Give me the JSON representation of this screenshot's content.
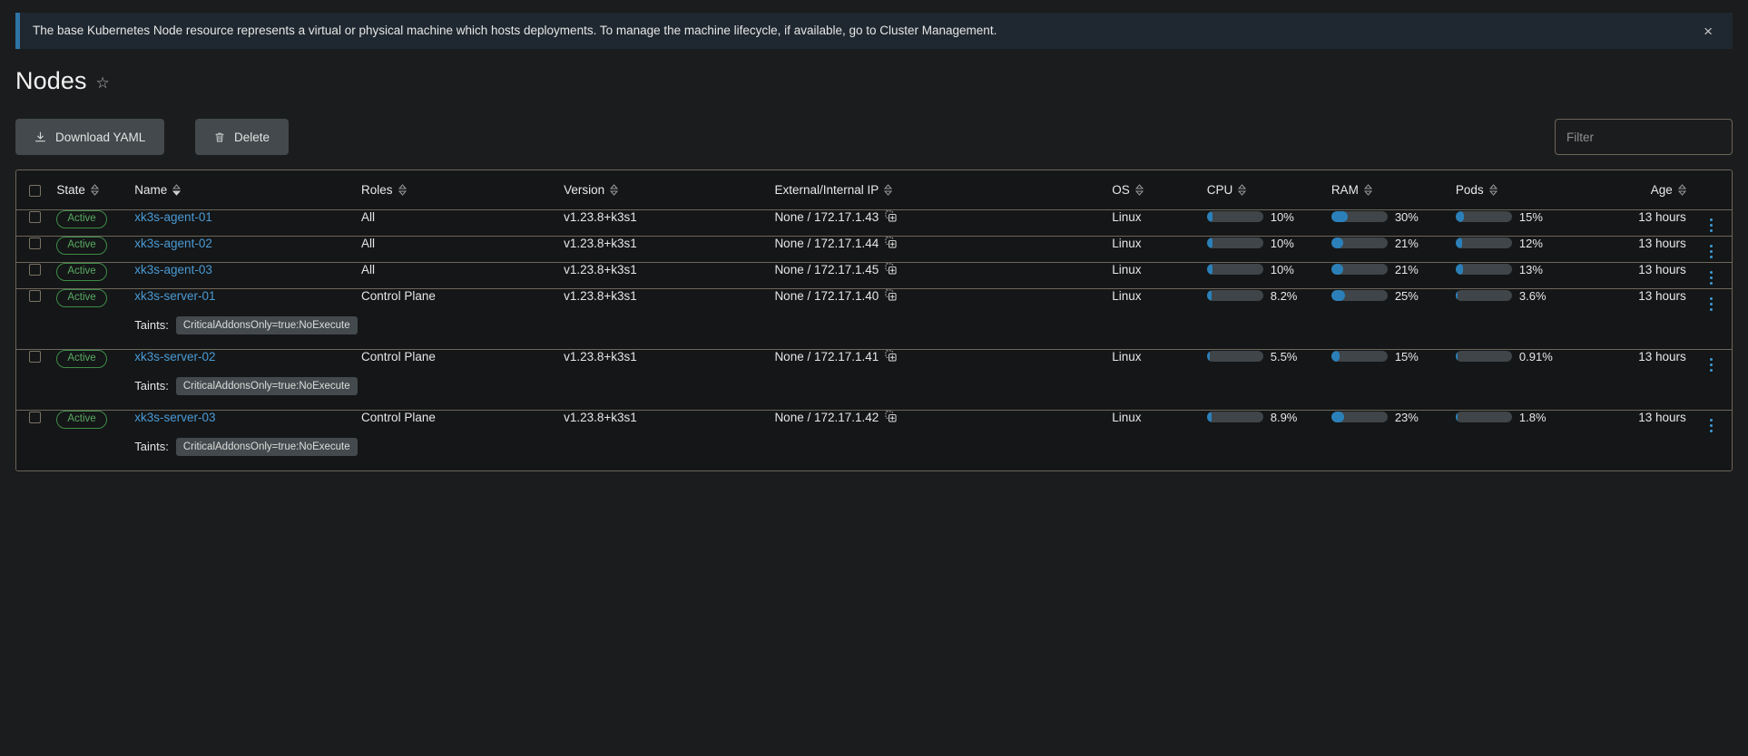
{
  "banner": {
    "message": "The base Kubernetes Node resource represents a virtual or physical machine which hosts deployments. To manage the machine lifecycle, if available, go to Cluster Management.",
    "close_label": "×",
    "accent_color": "#2e75a6",
    "background_color": "#1f2830"
  },
  "header": {
    "title": "Nodes",
    "favorite_icon": "star-icon"
  },
  "toolbar": {
    "download_yaml_label": "Download YAML",
    "download_icon": "download-icon",
    "delete_label": "Delete",
    "delete_icon": "trash-icon",
    "filter_placeholder": "Filter",
    "filter_value": ""
  },
  "table": {
    "columns": [
      {
        "key": "state",
        "label": "State",
        "sortable": true,
        "sorted": false
      },
      {
        "key": "name",
        "label": "Name",
        "sortable": true,
        "sorted": true
      },
      {
        "key": "roles",
        "label": "Roles",
        "sortable": true,
        "sorted": false
      },
      {
        "key": "version",
        "label": "Version",
        "sortable": true,
        "sorted": false
      },
      {
        "key": "ip",
        "label": "External/Internal IP",
        "sortable": true,
        "sorted": false
      },
      {
        "key": "os",
        "label": "OS",
        "sortable": true,
        "sorted": false
      },
      {
        "key": "cpu",
        "label": "CPU",
        "sortable": true,
        "sorted": false
      },
      {
        "key": "ram",
        "label": "RAM",
        "sortable": true,
        "sorted": false
      },
      {
        "key": "pods",
        "label": "Pods",
        "sortable": true,
        "sorted": false
      },
      {
        "key": "age",
        "label": "Age",
        "sortable": true,
        "sorted": false
      }
    ],
    "taints_label": "Taints:",
    "rows": [
      {
        "state": "Active",
        "name": "xk3s-agent-01",
        "roles": "All",
        "version": "v1.23.8+k3s1",
        "ip": "None / 172.17.1.43",
        "os": "Linux",
        "cpu": {
          "percent": 10,
          "text": "10%"
        },
        "ram": {
          "percent": 30,
          "text": "30%"
        },
        "pods": {
          "percent": 15,
          "text": "15%"
        },
        "age": "13 hours",
        "taints": null
      },
      {
        "state": "Active",
        "name": "xk3s-agent-02",
        "roles": "All",
        "version": "v1.23.8+k3s1",
        "ip": "None / 172.17.1.44",
        "os": "Linux",
        "cpu": {
          "percent": 10,
          "text": "10%"
        },
        "ram": {
          "percent": 21,
          "text": "21%"
        },
        "pods": {
          "percent": 12,
          "text": "12%"
        },
        "age": "13 hours",
        "taints": null
      },
      {
        "state": "Active",
        "name": "xk3s-agent-03",
        "roles": "All",
        "version": "v1.23.8+k3s1",
        "ip": "None / 172.17.1.45",
        "os": "Linux",
        "cpu": {
          "percent": 10,
          "text": "10%"
        },
        "ram": {
          "percent": 21,
          "text": "21%"
        },
        "pods": {
          "percent": 13,
          "text": "13%"
        },
        "age": "13 hours",
        "taints": null
      },
      {
        "state": "Active",
        "name": "xk3s-server-01",
        "roles": "Control Plane",
        "version": "v1.23.8+k3s1",
        "ip": "None / 172.17.1.40",
        "os": "Linux",
        "cpu": {
          "percent": 8.2,
          "text": "8.2%"
        },
        "ram": {
          "percent": 25,
          "text": "25%"
        },
        "pods": {
          "percent": 3.6,
          "text": "3.6%"
        },
        "age": "13 hours",
        "taints": "CriticalAddonsOnly=true:NoExecute"
      },
      {
        "state": "Active",
        "name": "xk3s-server-02",
        "roles": "Control Plane",
        "version": "v1.23.8+k3s1",
        "ip": "None / 172.17.1.41",
        "os": "Linux",
        "cpu": {
          "percent": 5.5,
          "text": "5.5%"
        },
        "ram": {
          "percent": 15,
          "text": "15%"
        },
        "pods": {
          "percent": 0.91,
          "text": "0.91%"
        },
        "age": "13 hours",
        "taints": "CriticalAddonsOnly=true:NoExecute"
      },
      {
        "state": "Active",
        "name": "xk3s-server-03",
        "roles": "Control Plane",
        "version": "v1.23.8+k3s1",
        "ip": "None / 172.17.1.42",
        "os": "Linux",
        "cpu": {
          "percent": 8.9,
          "text": "8.9%"
        },
        "ram": {
          "percent": 23,
          "text": "23%"
        },
        "pods": {
          "percent": 1.8,
          "text": "1.8%"
        },
        "age": "13 hours",
        "taints": "CriticalAddonsOnly=true:NoExecute"
      }
    ]
  },
  "colors": {
    "accent_blue": "#2b80b9",
    "link_blue": "#4b9ad4",
    "active_green": "#5aaa63",
    "border": "#6d665a",
    "row_bg": "#141617",
    "page_bg": "#1b1c1d"
  }
}
